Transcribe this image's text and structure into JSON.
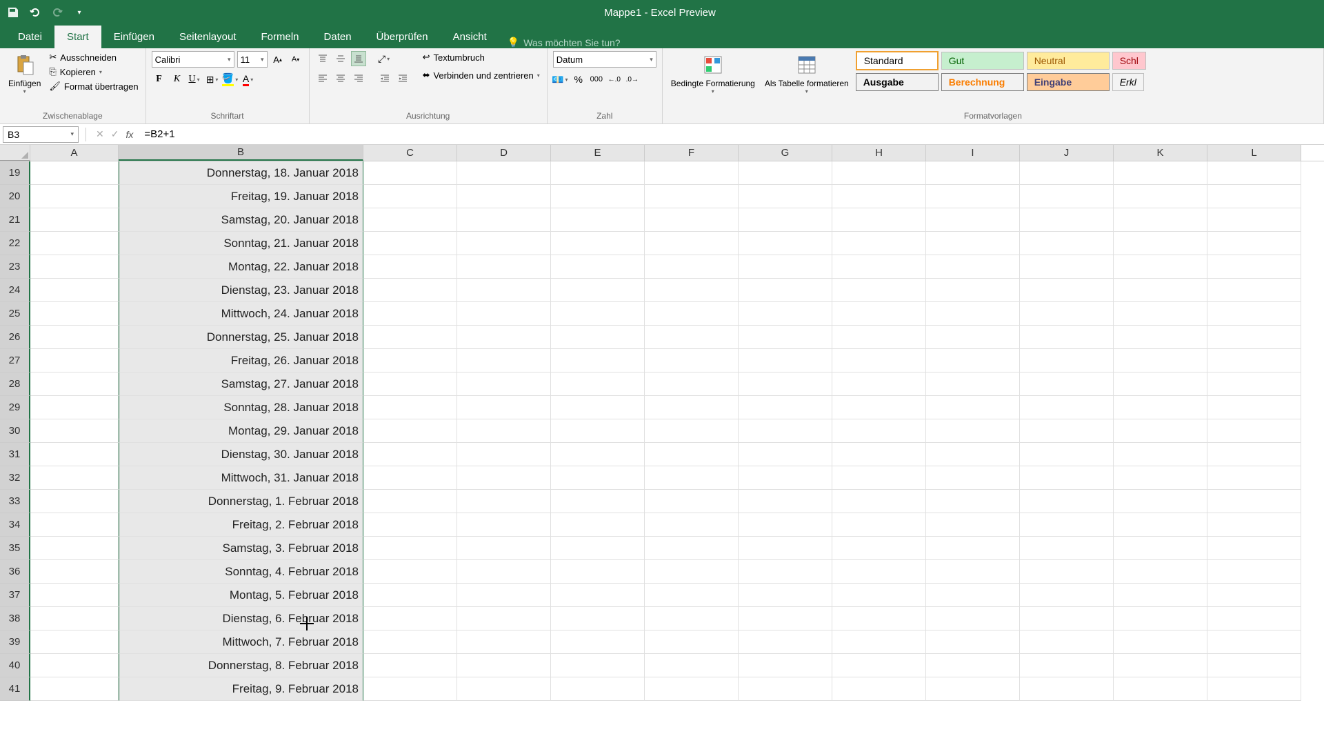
{
  "titlebar": {
    "title": "Mappe1  -  Excel Preview"
  },
  "tabs": {
    "datei": "Datei",
    "start": "Start",
    "einfuegen": "Einfügen",
    "seitenlayout": "Seitenlayout",
    "formeln": "Formeln",
    "daten": "Daten",
    "ueberpruefen": "Überprüfen",
    "ansicht": "Ansicht",
    "tellme": "Was möchten Sie tun?"
  },
  "ribbon": {
    "clipboard": {
      "paste": "Einfügen",
      "cut": "Ausschneiden",
      "copy": "Kopieren",
      "format_painter": "Format übertragen",
      "group": "Zwischenablage"
    },
    "font": {
      "name": "Calibri",
      "size": "11",
      "group": "Schriftart"
    },
    "alignment": {
      "wrap": "Textumbruch",
      "merge": "Verbinden und zentrieren",
      "group": "Ausrichtung"
    },
    "number": {
      "format": "Datum",
      "group": "Zahl"
    },
    "styles": {
      "conditional": "Bedingte Formatierung",
      "as_table": "Als Tabelle formatieren",
      "standard": "Standard",
      "gut": "Gut",
      "neutral": "Neutral",
      "schlecht": "Schl",
      "ausgabe": "Ausgabe",
      "berechnung": "Berechnung",
      "eingabe": "Eingabe",
      "erklarung": "Erkl",
      "group": "Formatvorlagen"
    }
  },
  "formula_bar": {
    "name_box": "B3",
    "formula": "=B2+1"
  },
  "columns": [
    "A",
    "B",
    "C",
    "D",
    "E",
    "F",
    "G",
    "H",
    "I",
    "J",
    "K",
    "L"
  ],
  "selected_column": "B",
  "rows": [
    {
      "num": 19,
      "b": "Donnerstag, 18. Januar 2018"
    },
    {
      "num": 20,
      "b": "Freitag, 19. Januar 2018"
    },
    {
      "num": 21,
      "b": "Samstag, 20. Januar 2018"
    },
    {
      "num": 22,
      "b": "Sonntag, 21. Januar 2018"
    },
    {
      "num": 23,
      "b": "Montag, 22. Januar 2018"
    },
    {
      "num": 24,
      "b": "Dienstag, 23. Januar 2018"
    },
    {
      "num": 25,
      "b": "Mittwoch, 24. Januar 2018"
    },
    {
      "num": 26,
      "b": "Donnerstag, 25. Januar 2018"
    },
    {
      "num": 27,
      "b": "Freitag, 26. Januar 2018"
    },
    {
      "num": 28,
      "b": "Samstag, 27. Januar 2018"
    },
    {
      "num": 29,
      "b": "Sonntag, 28. Januar 2018"
    },
    {
      "num": 30,
      "b": "Montag, 29. Januar 2018"
    },
    {
      "num": 31,
      "b": "Dienstag, 30. Januar 2018"
    },
    {
      "num": 32,
      "b": "Mittwoch, 31. Januar 2018"
    },
    {
      "num": 33,
      "b": "Donnerstag, 1. Februar 2018"
    },
    {
      "num": 34,
      "b": "Freitag, 2. Februar 2018"
    },
    {
      "num": 35,
      "b": "Samstag, 3. Februar 2018"
    },
    {
      "num": 36,
      "b": "Sonntag, 4. Februar 2018"
    },
    {
      "num": 37,
      "b": "Montag, 5. Februar 2018"
    },
    {
      "num": 38,
      "b": "Dienstag, 6. Februar 2018"
    },
    {
      "num": 39,
      "b": "Mittwoch, 7. Februar 2018"
    },
    {
      "num": 40,
      "b": "Donnerstag, 8. Februar 2018"
    },
    {
      "num": 41,
      "b": "Freitag, 9. Februar 2018"
    }
  ]
}
